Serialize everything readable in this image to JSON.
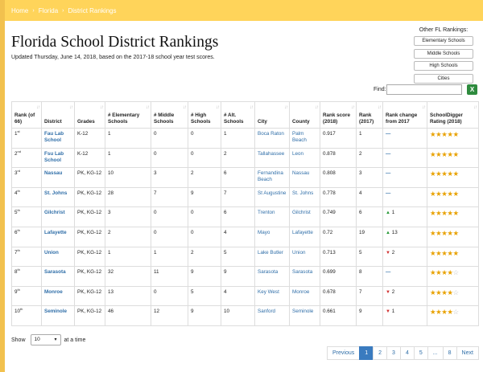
{
  "breadcrumb": [
    "Home",
    "Florida",
    "District Rankings"
  ],
  "title": "Florida School District Rankings",
  "updated": "Updated Thursday, June 14, 2018, based on the 2017-18 school year test scores.",
  "other": {
    "title": "Other FL Rankings:",
    "buttons": [
      "Elementary Schools",
      "Middle Schools",
      "High Schools",
      "Cities"
    ]
  },
  "find_label": "Find:",
  "columns": [
    "Rank (of 66)",
    "District",
    "Grades",
    "# Elementary Schools",
    "# Middle Schools",
    "# High Schools",
    "# Alt. Schools",
    "City",
    "County",
    "Rank score (2018)",
    "Rank (2017)",
    "Rank change from 2017",
    "SchoolDigger Rating (2018)"
  ],
  "rows": [
    {
      "rank": "1",
      "sup": "st",
      "district": "Fau Lab School",
      "grades": "K-12",
      "elem": "1",
      "mid": "0",
      "high": "0",
      "alt": "1",
      "city": "Boca Raton",
      "county": "Palm Beach",
      "score": "0.917",
      "rank2017": "1",
      "change": {
        "dir": "none",
        "val": ""
      },
      "stars": 5
    },
    {
      "rank": "2",
      "sup": "nd",
      "district": "Fsu Lab School",
      "grades": "K-12",
      "elem": "1",
      "mid": "0",
      "high": "0",
      "alt": "2",
      "city": "Tallahassee",
      "county": "Leon",
      "score": "0.878",
      "rank2017": "2",
      "change": {
        "dir": "none",
        "val": ""
      },
      "stars": 5
    },
    {
      "rank": "3",
      "sup": "rd",
      "district": "Nassau",
      "grades": "PK, KG-12",
      "elem": "10",
      "mid": "3",
      "high": "2",
      "alt": "6",
      "city": "Fernandina Beach",
      "county": "Nassau",
      "score": "0.808",
      "rank2017": "3",
      "change": {
        "dir": "none",
        "val": ""
      },
      "stars": 5
    },
    {
      "rank": "4",
      "sup": "th",
      "district": "St. Johns",
      "grades": "PK, KG-12",
      "elem": "28",
      "mid": "7",
      "high": "9",
      "alt": "7",
      "city": "St Augustine",
      "county": "St. Johns",
      "score": "0.778",
      "rank2017": "4",
      "change": {
        "dir": "none",
        "val": ""
      },
      "stars": 5
    },
    {
      "rank": "5",
      "sup": "th",
      "district": "Gilchrist",
      "grades": "PK, KG-12",
      "elem": "3",
      "mid": "0",
      "high": "0",
      "alt": "6",
      "city": "Trenton",
      "county": "Gilchrist",
      "score": "0.749",
      "rank2017": "6",
      "change": {
        "dir": "up",
        "val": "1"
      },
      "stars": 5
    },
    {
      "rank": "6",
      "sup": "th",
      "district": "Lafayette",
      "grades": "PK, KG-12",
      "elem": "2",
      "mid": "0",
      "high": "0",
      "alt": "4",
      "city": "Mayo",
      "county": "Lafayette",
      "score": "0.72",
      "rank2017": "19",
      "change": {
        "dir": "up",
        "val": "13"
      },
      "stars": 5
    },
    {
      "rank": "7",
      "sup": "th",
      "district": "Union",
      "grades": "PK, KG-12",
      "elem": "1",
      "mid": "1",
      "high": "2",
      "alt": "5",
      "city": "Lake Butler",
      "county": "Union",
      "score": "0.713",
      "rank2017": "5",
      "change": {
        "dir": "down",
        "val": "2"
      },
      "stars": 5
    },
    {
      "rank": "8",
      "sup": "th",
      "district": "Sarasota",
      "grades": "PK, KG-12",
      "elem": "32",
      "mid": "11",
      "high": "9",
      "alt": "9",
      "city": "Sarasota",
      "county": "Sarasota",
      "score": "0.699",
      "rank2017": "8",
      "change": {
        "dir": "none",
        "val": ""
      },
      "stars": 4
    },
    {
      "rank": "9",
      "sup": "th",
      "district": "Monroe",
      "grades": "PK, KG-12",
      "elem": "13",
      "mid": "0",
      "high": "5",
      "alt": "4",
      "city": "Key West",
      "county": "Monroe",
      "score": "0.678",
      "rank2017": "7",
      "change": {
        "dir": "down",
        "val": "2"
      },
      "stars": 4
    },
    {
      "rank": "10",
      "sup": "th",
      "district": "Seminole",
      "grades": "PK, KG-12",
      "elem": "46",
      "mid": "12",
      "high": "9",
      "alt": "10",
      "city": "Sanford",
      "county": "Seminole",
      "score": "0.661",
      "rank2017": "9",
      "change": {
        "dir": "down",
        "val": "1"
      },
      "stars": 4
    }
  ],
  "show": {
    "label": "Show",
    "value": "10",
    "suffix": "at a time"
  },
  "pager": [
    "Previous",
    "1",
    "2",
    "3",
    "4",
    "5",
    "...",
    "8",
    "Next"
  ],
  "pager_active": "1",
  "colors": {
    "header": "#ffd45a",
    "link": "#2f6ea8",
    "star": "#e8a100",
    "active": "#3a7bbf"
  }
}
